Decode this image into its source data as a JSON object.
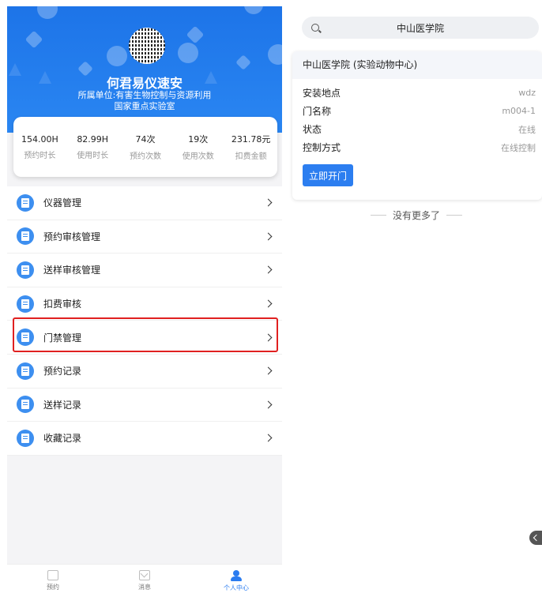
{
  "profile": {
    "name": "何君易仪速安",
    "unit_line1": "所属单位:有害生物控制与资源利用",
    "unit_line2": "国家重点实验室"
  },
  "stats": [
    {
      "value": "154.00H",
      "label": "预约时长"
    },
    {
      "value": "82.99H",
      "label": "使用时长"
    },
    {
      "value": "74次",
      "label": "预约次数"
    },
    {
      "value": "19次",
      "label": "使用次数"
    },
    {
      "value": "231.78元",
      "label": "扣费金额"
    }
  ],
  "menu": [
    {
      "label": "仪器管理",
      "icon": "document-icon"
    },
    {
      "label": "预约审核管理",
      "icon": "document-icon"
    },
    {
      "label": "送样审核管理",
      "icon": "document-icon"
    },
    {
      "label": "扣费审核",
      "icon": "document-icon"
    },
    {
      "label": "门禁管理",
      "icon": "document-icon"
    },
    {
      "label": "预约记录",
      "icon": "document-icon"
    },
    {
      "label": "送样记录",
      "icon": "document-icon"
    },
    {
      "label": "收藏记录",
      "icon": "document-icon"
    }
  ],
  "tabbar": [
    {
      "label": "预约",
      "icon": "calendar-icon"
    },
    {
      "label": "消息",
      "icon": "mail-icon"
    },
    {
      "label": "个人中心",
      "icon": "person-icon",
      "active": true
    }
  ],
  "search": {
    "value": "中山医学院"
  },
  "door_card": {
    "title": "中山医学院 (实验动物中心)",
    "rows": [
      {
        "key": "安装地点",
        "value": "wdz"
      },
      {
        "key": "门名称",
        "value": "m004-1"
      },
      {
        "key": "状态",
        "value": "在线"
      },
      {
        "key": "控制方式",
        "value": "在线控制"
      }
    ],
    "button": "立即开门"
  },
  "no_more": "没有更多了",
  "colors": {
    "primary": "#2c7ef0",
    "highlight": "#e02020"
  }
}
